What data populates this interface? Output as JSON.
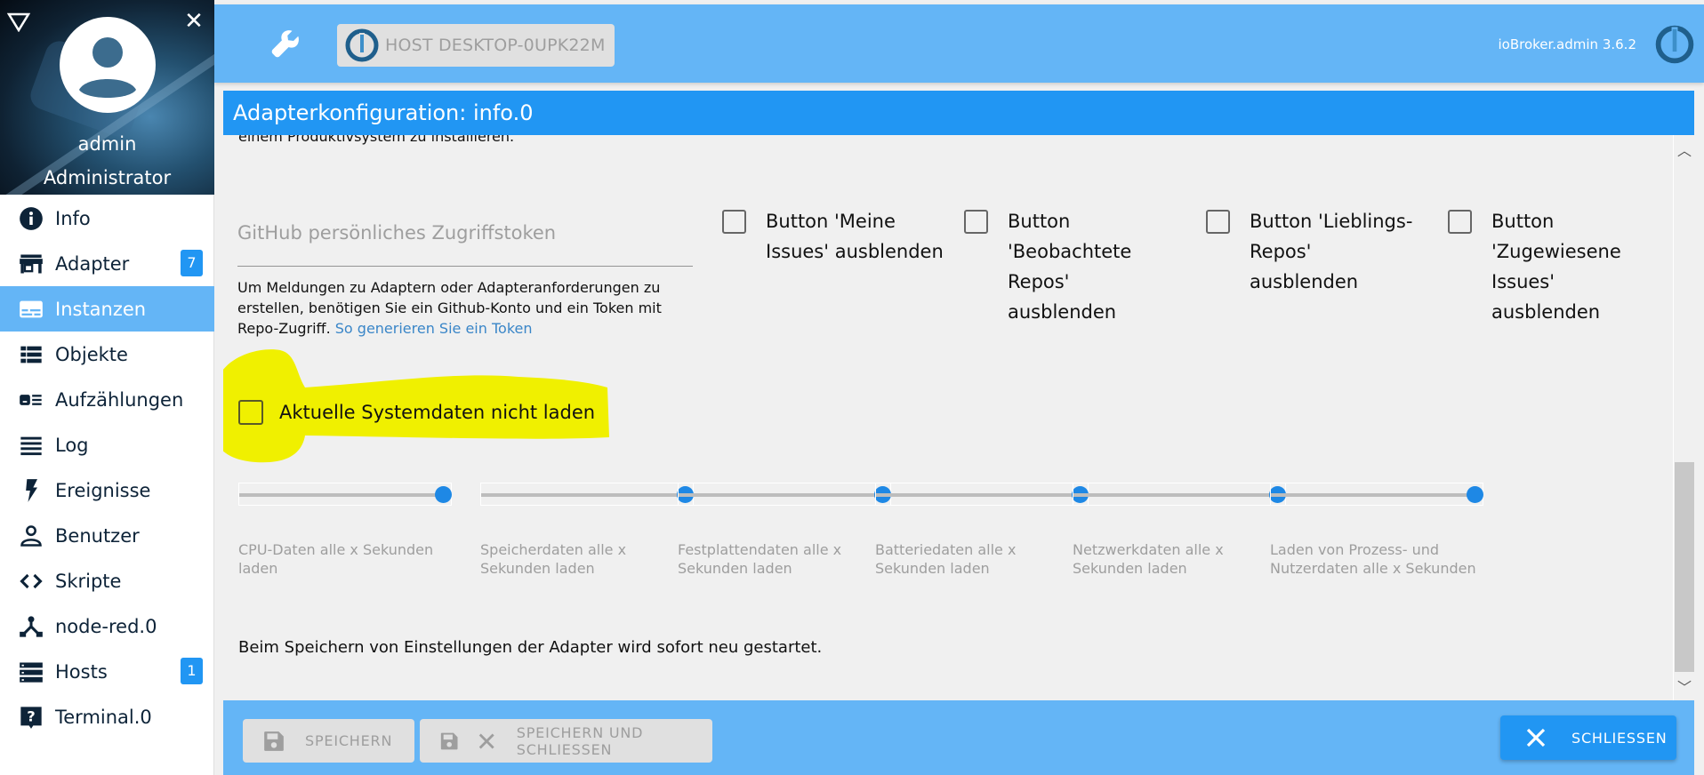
{
  "sidebar": {
    "user_name": "admin",
    "user_role": "Administrator",
    "items": [
      {
        "label": "Info",
        "icon": "info-icon",
        "badge": null,
        "active": false
      },
      {
        "label": "Adapter",
        "icon": "store-icon",
        "badge": "7",
        "active": false
      },
      {
        "label": "Instanzen",
        "icon": "instances-icon",
        "badge": null,
        "active": true
      },
      {
        "label": "Objekte",
        "icon": "list-icon",
        "badge": null,
        "active": false
      },
      {
        "label": "Aufzählungen",
        "icon": "enum-icon",
        "badge": null,
        "active": false
      },
      {
        "label": "Log",
        "icon": "log-icon",
        "badge": null,
        "active": false
      },
      {
        "label": "Ereignisse",
        "icon": "flash-icon",
        "badge": null,
        "active": false
      },
      {
        "label": "Benutzer",
        "icon": "user-icon",
        "badge": null,
        "active": false
      },
      {
        "label": "Skripte",
        "icon": "code-icon",
        "badge": null,
        "active": false
      },
      {
        "label": "node-red.0",
        "icon": "node-red-icon",
        "badge": null,
        "active": false
      },
      {
        "label": "Hosts",
        "icon": "hosts-icon",
        "badge": "1",
        "active": false
      },
      {
        "label": "Terminal.0",
        "icon": "help-icon",
        "badge": null,
        "active": false
      }
    ]
  },
  "topbar": {
    "host_label": "HOST DESKTOP-0UPK22M",
    "version": "ioBroker.admin 3.6.2"
  },
  "dialog": {
    "title": "Adapterkonfiguration: info.0",
    "cut_text": "einem Produktivsystem zu installieren.",
    "github_token": {
      "label": "GitHub persönliches Zugriffstoken",
      "value": "",
      "help_text": "Um Meldungen zu Adaptern oder Adapteranforderungen zu erstellen, benötigen Sie ein Github-Konto und ein Token mit Repo-Zugriff.",
      "help_link": "So generieren Sie ein Token"
    },
    "hide_buttons": [
      {
        "label": "Button 'Meine Issues' ausblenden",
        "checked": false
      },
      {
        "label": "Button 'Beobachtete Repos' ausblenden",
        "checked": false
      },
      {
        "label": "Button 'Lieblings-Repos' ausblenden",
        "checked": false
      },
      {
        "label": "Button 'Zugewiesene Issues' ausblenden",
        "checked": false
      }
    ],
    "no_sysdata": {
      "label": "Aktuelle Systemdaten nicht laden",
      "checked": false,
      "highlighted": true,
      "highlight_color": "#f0f000"
    },
    "sliders": [
      {
        "label": "CPU-Daten alle x Sekunden laden",
        "value_fraction": 1.0
      },
      {
        "label": "Speicherdaten alle x Sekunden laden",
        "value_fraction": 1.0
      },
      {
        "label": "Festplattendaten alle x Sekunden laden",
        "value_fraction": 1.0
      },
      {
        "label": "Batteriedaten alle x Sekunden laden",
        "value_fraction": 1.0
      },
      {
        "label": "Netzwerkdaten alle x Sekunden laden",
        "value_fraction": 1.0
      },
      {
        "label": "Laden von Prozess- und Nutzerdaten alle x Sekunden",
        "value_fraction": 1.0
      }
    ],
    "save_note": "Beim Speichern von Einstellungen der Adapter wird sofort neu gestartet."
  },
  "footer": {
    "save_label": "SPEICHERN",
    "save_close_label": "SPEICHERN UND SCHLIESSEN",
    "close_label": "SCHLIESSEN"
  },
  "colors": {
    "primary": "#2196f3",
    "header": "#64b5f6",
    "sidebar_text": "#0d2338",
    "slider_thumb": "#1e88e5",
    "disabled_button": "#e0e0e0"
  }
}
